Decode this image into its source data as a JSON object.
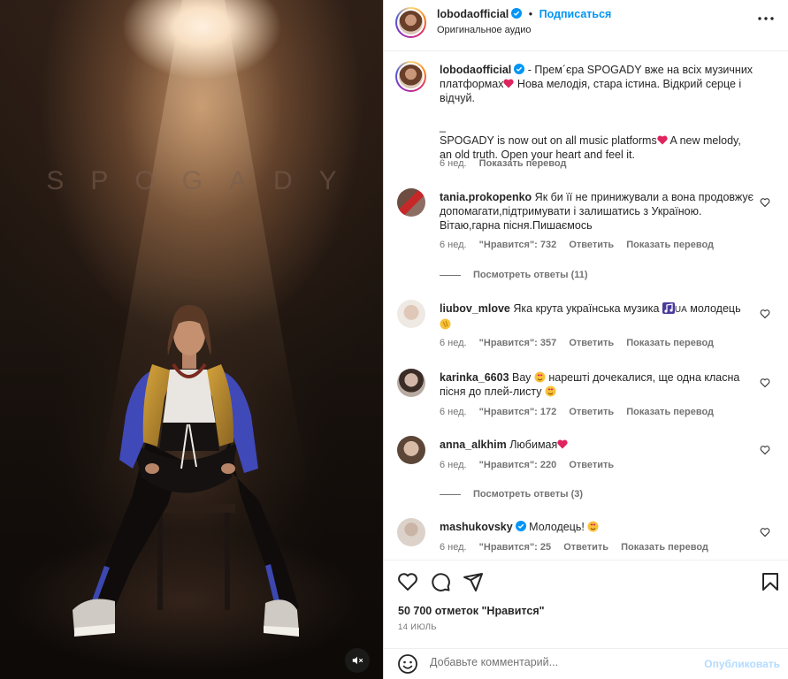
{
  "media": {
    "title_text": "SPOGADY",
    "mute_icon": "speaker-muted-icon"
  },
  "header": {
    "username": "lobodaofficial",
    "separator": "•",
    "follow_label": "Подписаться",
    "audio_label": "Оригинальное аудио"
  },
  "caption": {
    "username": "lobodaofficial",
    "text_line1": "- Прем´єра SPOGADY вже на всіх музичних",
    "text_line2a": "платформах",
    "text_line2b": " Нова мелодія, стара істина. Відкрий серце і",
    "text_line3": "відчуй.",
    "text_line4": "_",
    "text_line5a": "SPOGADY is now out on all music platforms",
    "text_line5b": " A new melody,",
    "text_line6": "an old truth. Open your heart and feel it.",
    "time": "6 нед.",
    "translate": "Показать перевод"
  },
  "comments": [
    {
      "username": "tania.prokopenko",
      "text": "Як би її не принижували а вона продовжує допомагати,підтримувати і залишатись з Україною. Вітаю,гарна пісня.Пишаємось",
      "time": "6 нед.",
      "likes": "\"Нравится\": 732",
      "reply": "Ответить",
      "translate": "Показать перевод",
      "replies": "Посмотреть ответы (11)"
    },
    {
      "username": "liubov_mlove",
      "text_a": "Яка крута українська музика ",
      "text_flag": "UA",
      "text_b": " молодець",
      "time": "6 нед.",
      "likes": "\"Нравится\": 357",
      "reply": "Ответить",
      "translate": "Показать перевод"
    },
    {
      "username": "karinka_6603",
      "text_a": "Вау ",
      "text_b": " нарешті дочекалися, ще одна класна пісня до плей-листу ",
      "time": "6 нед.",
      "likes": "\"Нравится\": 172",
      "reply": "Ответить",
      "translate": "Показать перевод"
    },
    {
      "username": "anna_alkhim",
      "text": "Любимая",
      "time": "6 нед.",
      "likes": "\"Нравится\": 220",
      "reply": "Ответить",
      "replies": "Посмотреть ответы (3)"
    },
    {
      "username": "mashukovsky",
      "text": "Молодець! ",
      "time": "6 нед.",
      "likes": "\"Нравится\": 25",
      "reply": "Ответить",
      "translate": "Показать перевод"
    }
  ],
  "footer": {
    "likes": "50 700 отметок \"Нравится\"",
    "date": "14 ИЮЛЬ",
    "comment_placeholder": "Добавьте комментарий...",
    "publish_label": "Опубликовать"
  },
  "colors": {
    "accent": "#0095f6",
    "heart": "#e0245e",
    "text": "#262626",
    "muted": "#737373"
  }
}
